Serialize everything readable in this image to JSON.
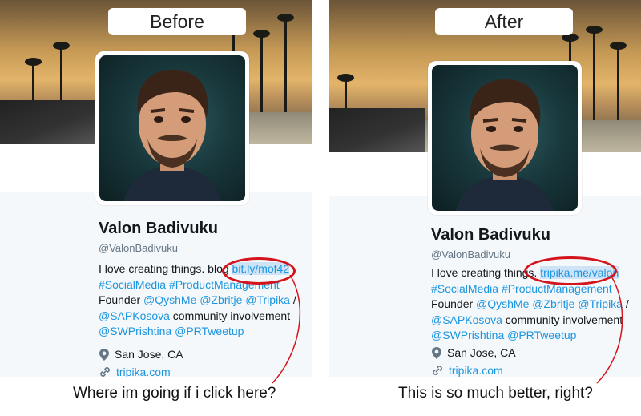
{
  "before": {
    "tag": "Before",
    "profile": {
      "name": "Valon Badivuku",
      "handle": "@ValonBadivuku",
      "bio_lead": "I love creating things. blog ",
      "bio_link": "bit.ly/mof42",
      "hashtags": "#SocialMedia #ProductManagement",
      "founder_label": "Founder ",
      "mentions_1": "@QyshMe @Zbritje @Tripika",
      "slash": " /",
      "mention_sapkosova": "@SAPKosova",
      "community_text": " community involvement",
      "mentions_2": "@SWPrishtina @PRTweetup",
      "location": "San Jose, CA",
      "website": "tripika.com"
    },
    "caption": "Where im going if i click here?"
  },
  "after": {
    "tag": "After",
    "profile": {
      "name": "Valon Badivuku",
      "handle": "@ValonBadivuku",
      "bio_lead": "I love creating things. ",
      "bio_link": "tripika.me/valon",
      "hashtags": "#SocialMedia #ProductManagement",
      "founder_label": "Founder ",
      "mentions_1": "@QyshMe @Zbritje @Tripika",
      "slash": " /",
      "mention_sapkosova": "@SAPKosova",
      "community_text": " community involvement",
      "mentions_2": "@SWPrishtina @PRTweetup",
      "location": "San Jose, CA",
      "website": "tripika.com"
    },
    "caption": "This is so much better, right?"
  },
  "colors": {
    "link": "#1b95e0",
    "highlight_circle": "#d4141c",
    "link_selection": "#cfe3f7"
  },
  "icons": {
    "location": "map-pin-icon",
    "website": "link-icon"
  }
}
